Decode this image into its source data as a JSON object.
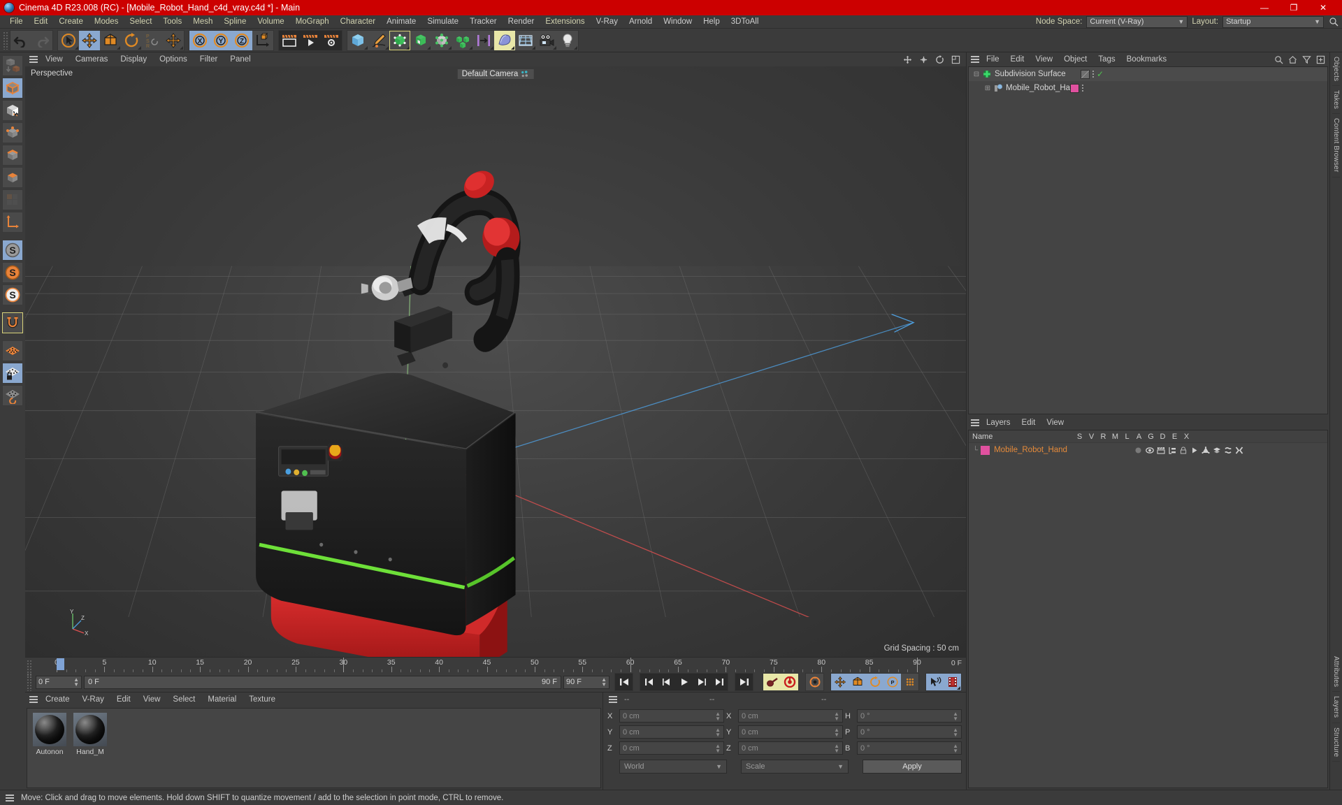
{
  "window": {
    "title": "Cinema 4D R23.008 (RC) - [Mobile_Robot_Hand_c4d_vray.c4d *] - Main",
    "minimize": "—",
    "maximize": "❐",
    "close": "✕"
  },
  "menubar": {
    "items": [
      "File",
      "Edit",
      "Create",
      "Modes",
      "Select",
      "Tools",
      "Mesh",
      "Spline",
      "Volume",
      "MoGraph",
      "Character",
      "Animate",
      "Simulate",
      "Tracker",
      "Render",
      "Extensions",
      "V-Ray",
      "Arnold",
      "Window",
      "Help",
      "3DToAll"
    ],
    "node_space_label": "Node Space:",
    "node_space_value": "Current (V-Ray)",
    "layout_label": "Layout:",
    "layout_value": "Startup",
    "search_icon": "search-icon"
  },
  "toolbar": {
    "groups": [
      {
        "name": "undo-redo",
        "buttons": [
          {
            "name": "undo-button",
            "icon": "undo-arrow",
            "state": "normal"
          },
          {
            "name": "redo-button",
            "icon": "redo-arrow",
            "state": "disabled"
          }
        ]
      },
      {
        "name": "transform-tools",
        "buttons": [
          {
            "name": "live-selection-tool",
            "icon": "cursor-circle",
            "state": "normal"
          },
          {
            "name": "move-tool",
            "icon": "move-cross",
            "state": "selected"
          },
          {
            "name": "scale-tool",
            "icon": "scale-box",
            "state": "normal"
          },
          {
            "name": "rotate-tool",
            "icon": "rotate-arc",
            "state": "normal"
          },
          {
            "name": "psr-tool",
            "icon": "psr-text",
            "state": "normal"
          },
          {
            "name": "dynamics-place-tool",
            "icon": "move-cross-alt",
            "state": "normal"
          }
        ]
      },
      {
        "name": "axis-locks",
        "buttons": [
          {
            "name": "lock-x-axis-button",
            "icon": "x-circle",
            "state": "selected"
          },
          {
            "name": "lock-y-axis-button",
            "icon": "y-circle",
            "state": "selected"
          },
          {
            "name": "lock-z-axis-button",
            "icon": "z-circle",
            "state": "selected"
          },
          {
            "name": "world-object-axis-button",
            "icon": "axis-cube",
            "state": "normal"
          }
        ]
      },
      {
        "name": "render-tools",
        "buttons": [
          {
            "name": "render-view-button",
            "icon": "render-view",
            "state": "dark"
          },
          {
            "name": "render-to-picture-viewer-button",
            "icon": "render-picture",
            "state": "dark"
          },
          {
            "name": "render-settings-button",
            "icon": "render-settings",
            "state": "dark"
          }
        ]
      },
      {
        "name": "object-tools",
        "buttons": [
          {
            "name": "cube-primitive-button",
            "icon": "blue-cube",
            "state": "normal"
          },
          {
            "name": "spline-pen-button",
            "icon": "pen-spline",
            "state": "normal"
          },
          {
            "name": "subdivision-surface-button",
            "icon": "green-cage-cube",
            "state": "outlined"
          },
          {
            "name": "array-generator-button",
            "icon": "green-cube-open",
            "state": "normal"
          },
          {
            "name": "deformer-button",
            "icon": "green-points-cube",
            "state": "normal"
          },
          {
            "name": "mograph-cloner-button",
            "icon": "green-cubes",
            "state": "normal"
          },
          {
            "name": "field-button",
            "icon": "purple-bars",
            "state": "normal"
          },
          {
            "name": "nurbs-button",
            "icon": "blue-blob",
            "state": "selectedY"
          },
          {
            "name": "scene-grid-button",
            "icon": "blue-grid",
            "state": "normal"
          },
          {
            "name": "camera-button",
            "icon": "camera",
            "state": "normal"
          },
          {
            "name": "light-button",
            "icon": "light-bulb",
            "state": "normal"
          }
        ]
      }
    ]
  },
  "leftbar": {
    "buttons": [
      {
        "name": "make-editable-button",
        "icon": "make-editable",
        "state": "normal"
      },
      {
        "name": "model-mode-button",
        "icon": "orange-cube-mode",
        "state": "selected"
      },
      {
        "name": "texture-mode-button",
        "icon": "checker-cube",
        "state": "normal"
      },
      {
        "name": "point-mode-button",
        "icon": "point-cube",
        "state": "normal"
      },
      {
        "name": "edge-mode-button",
        "icon": "edge-cube",
        "state": "normal"
      },
      {
        "name": "polygon-mode-button",
        "icon": "polygon-cube",
        "state": "normal"
      },
      {
        "name": "uv-mode-button",
        "icon": "uv-squares",
        "state": "disabled"
      },
      {
        "name": "axis-mode-button",
        "icon": "axis-corner",
        "state": "normal"
      },
      {
        "name": "enable-axis-modification-button",
        "icon": "s-gray",
        "state": "selected"
      },
      {
        "name": "soft-selection-button",
        "icon": "s-orange",
        "state": "normal"
      },
      {
        "name": "workplane-button",
        "icon": "s-white",
        "state": "normal"
      },
      {
        "name": "snap-enable-button",
        "icon": "magnet",
        "state": "outlined"
      },
      {
        "name": "quantize-button",
        "icon": "orange-grid",
        "state": "normal"
      },
      {
        "name": "lock-workplane-button",
        "icon": "grid-lock",
        "state": "selected"
      },
      {
        "name": "workplane-rotate-button",
        "icon": "grid-rotate",
        "state": "normal"
      }
    ]
  },
  "viewport": {
    "menu": [
      "View",
      "Cameras",
      "Display",
      "Options",
      "Filter",
      "Panel"
    ],
    "corner_label": "Perspective",
    "camera_label": "Default Camera",
    "grid_spacing": "Grid Spacing : 50 cm",
    "axis_labels": {
      "x": "X",
      "y": "Y",
      "z": "Z"
    },
    "right_icons": [
      "pan-icon",
      "zoom-icon",
      "rotate-icon",
      "maximize-icon"
    ]
  },
  "timeline": {
    "ruler_ticks": [
      0,
      5,
      10,
      15,
      20,
      25,
      30,
      35,
      40,
      45,
      50,
      55,
      60,
      65,
      70,
      75,
      80,
      85,
      90
    ],
    "playhead_frame": 0,
    "current_frame_right": "0 F",
    "current_frame_field": "0 F",
    "range_start": "0 F",
    "range_end_label": "90 F",
    "range_end_field": "90 F",
    "transport": [
      {
        "name": "go-to-start-button",
        "icon": "skip-start"
      },
      {
        "name": "previous-keyframe-button",
        "icon": "prev-key"
      },
      {
        "name": "step-back-button",
        "icon": "step-back"
      },
      {
        "name": "play-button",
        "icon": "play"
      },
      {
        "name": "step-forward-button",
        "icon": "step-forward"
      },
      {
        "name": "next-keyframe-button",
        "icon": "next-key"
      },
      {
        "name": "go-to-end-button",
        "icon": "skip-end"
      }
    ],
    "record_tools": [
      {
        "name": "autokey-button",
        "icon": "key-red",
        "state": "selectedY"
      },
      {
        "name": "record-button",
        "icon": "record-circle",
        "state": "selectedY"
      },
      {
        "name": "keyframe-settings-button",
        "icon": "gear-orange",
        "state": "normal"
      },
      {
        "name": "record-position-button",
        "icon": "move-cross",
        "state": "selected"
      },
      {
        "name": "record-scale-button",
        "icon": "scale-box",
        "state": "selected"
      },
      {
        "name": "record-rotation-button",
        "icon": "rotate-arc",
        "state": "selected"
      },
      {
        "name": "record-parameter-button",
        "icon": "p-circle",
        "state": "selected"
      },
      {
        "name": "record-pla-button",
        "icon": "dots-grid",
        "state": "normal"
      },
      {
        "name": "autokey-mode-button",
        "icon": "cursor-wave",
        "state": "selected"
      },
      {
        "name": "keyframe-selection-button",
        "icon": "film-strip",
        "state": "selected"
      }
    ]
  },
  "material_manager": {
    "menu": [
      "Create",
      "V-Ray",
      "Edit",
      "View",
      "Select",
      "Material",
      "Texture"
    ],
    "materials": [
      {
        "name": "Autonon",
        "swatch_color": "#1a1a1a"
      },
      {
        "name": "Hand_M",
        "swatch_color": "#1a1a1a"
      }
    ]
  },
  "coordinates": {
    "headers": [
      "--",
      "--",
      "--"
    ],
    "rows": [
      {
        "ax1": "X",
        "v1": "0 cm",
        "ax2": "X",
        "v2": "0 cm",
        "ax3": "H",
        "v3": "0 °"
      },
      {
        "ax1": "Y",
        "v1": "0 cm",
        "ax2": "Y",
        "v2": "0 cm",
        "ax3": "P",
        "v3": "0 °"
      },
      {
        "ax1": "Z",
        "v1": "0 cm",
        "ax2": "Z",
        "v2": "0 cm",
        "ax3": "B",
        "v3": "0 °"
      }
    ],
    "space_select": "World",
    "mode_select": "Scale",
    "apply_label": "Apply"
  },
  "object_manager": {
    "menu": [
      "File",
      "Edit",
      "View",
      "Object",
      "Tags",
      "Bookmarks"
    ],
    "right_icons": [
      "search-icon",
      "home-icon",
      "filter-icon",
      "add-icon"
    ],
    "objects": [
      {
        "name": "Subdivision Surface",
        "icon": "subdivision-surface-icon",
        "indent": 0,
        "tag_color": "#7a7a7a",
        "has_check": true,
        "selected": false
      },
      {
        "name": "Mobile_Robot_Hand",
        "icon": "polygon-object-icon",
        "indent": 1,
        "tag_color": "#e0519f",
        "has_check": false,
        "selected": false
      }
    ]
  },
  "layer_manager": {
    "menu": [
      "Layers",
      "Edit",
      "View"
    ],
    "columns": [
      "Name",
      "S",
      "V",
      "R",
      "M",
      "L",
      "A",
      "G",
      "D",
      "E",
      "X"
    ],
    "rows": [
      {
        "name": "Mobile_Robot_Hand",
        "color": "#e0519f"
      }
    ]
  },
  "dock_tabs_right": [
    "Objects",
    "Takes",
    "Content Browser"
  ],
  "dock_tabs_right2": [
    "Attributes",
    "Layers",
    "Structure"
  ],
  "statusbar": {
    "message": "Move: Click and drag to move elements. Hold down SHIFT to quantize movement / add to the selection in point mode, CTRL to remove."
  }
}
